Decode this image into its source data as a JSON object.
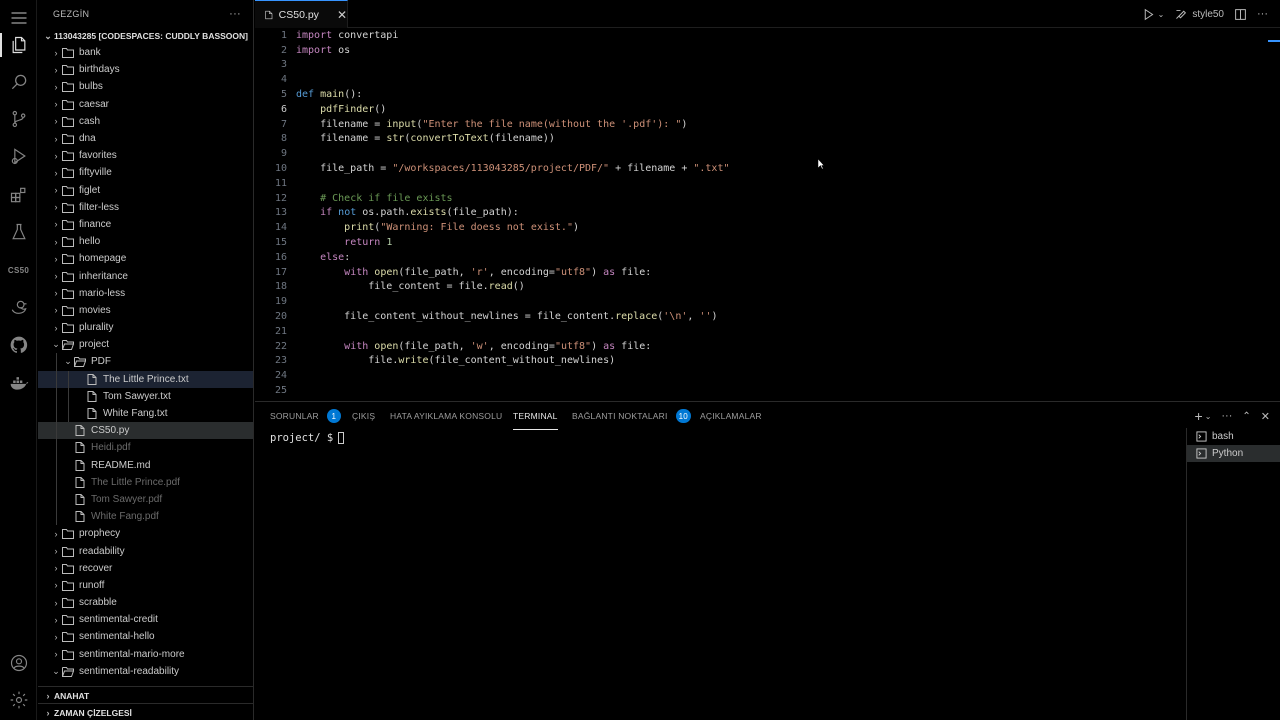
{
  "activity_bar": {
    "items": [
      {
        "icon": "menu-icon"
      },
      {
        "icon": "explorer-icon"
      },
      {
        "icon": "search-icon"
      },
      {
        "icon": "source-control-icon"
      },
      {
        "icon": "run-debug-icon"
      },
      {
        "icon": "extensions-icon"
      },
      {
        "icon": "testing-icon"
      },
      {
        "icon": "cs50-icon",
        "label": "CS50"
      },
      {
        "icon": "duck-icon"
      },
      {
        "icon": "github-icon"
      },
      {
        "icon": "docker-icon"
      },
      {
        "icon": "account-icon"
      },
      {
        "icon": "settings-icon"
      }
    ]
  },
  "sidebar": {
    "title": "GEZGİN",
    "more": "···",
    "workspace": "113043285 [CODESPACES: CUDDLY BASSOON]",
    "items": [
      {
        "label": "bank",
        "type": "folder"
      },
      {
        "label": "birthdays",
        "type": "folder"
      },
      {
        "label": "bulbs",
        "type": "folder"
      },
      {
        "label": "caesar",
        "type": "folder"
      },
      {
        "label": "cash",
        "type": "folder"
      },
      {
        "label": "dna",
        "type": "folder"
      },
      {
        "label": "favorites",
        "type": "folder"
      },
      {
        "label": "fiftyville",
        "type": "folder"
      },
      {
        "label": "figlet",
        "type": "folder"
      },
      {
        "label": "filter-less",
        "type": "folder"
      },
      {
        "label": "finance",
        "type": "folder"
      },
      {
        "label": "hello",
        "type": "folder"
      },
      {
        "label": "homepage",
        "type": "folder"
      },
      {
        "label": "inheritance",
        "type": "folder"
      },
      {
        "label": "mario-less",
        "type": "folder"
      },
      {
        "label": "movies",
        "type": "folder"
      },
      {
        "label": "plurality",
        "type": "folder"
      },
      {
        "label": "project",
        "type": "folder-open"
      },
      {
        "label": "PDF",
        "type": "folder-open"
      },
      {
        "label": "The Little Prince.txt",
        "type": "file"
      },
      {
        "label": "Tom Sawyer.txt",
        "type": "file"
      },
      {
        "label": "White Fang.txt",
        "type": "file"
      },
      {
        "label": "CS50.py",
        "type": "file"
      },
      {
        "label": "Heidi.pdf",
        "type": "file"
      },
      {
        "label": "README.md",
        "type": "file"
      },
      {
        "label": "The Little Prince.pdf",
        "type": "file"
      },
      {
        "label": "Tom Sawyer.pdf",
        "type": "file"
      },
      {
        "label": "White Fang.pdf",
        "type": "file"
      },
      {
        "label": "prophecy",
        "type": "folder"
      },
      {
        "label": "readability",
        "type": "folder"
      },
      {
        "label": "recover",
        "type": "folder"
      },
      {
        "label": "runoff",
        "type": "folder"
      },
      {
        "label": "scrabble",
        "type": "folder"
      },
      {
        "label": "sentimental-credit",
        "type": "folder"
      },
      {
        "label": "sentimental-hello",
        "type": "folder"
      },
      {
        "label": "sentimental-mario-more",
        "type": "folder"
      },
      {
        "label": "sentimental-readability",
        "type": "folder-open"
      }
    ],
    "outline": "ANAHAT",
    "timeline": "ZAMAN ÇİZELGESİ"
  },
  "editor": {
    "tab_label": "CS50.py",
    "tab_close": "✕",
    "toolbar_label": "style50",
    "current_line": "6",
    "lines": [
      {
        "n": "1",
        "html": "<span class='kw'>import</span> convertapi"
      },
      {
        "n": "2",
        "html": "<span class='kw'>import</span> os"
      },
      {
        "n": "3",
        "html": ""
      },
      {
        "n": "4",
        "html": ""
      },
      {
        "n": "5",
        "html": "<span class='def'>def</span> <span class='fn'>main</span>():"
      },
      {
        "n": "6",
        "html": "    <span class='fn'>pdfFinder</span>()"
      },
      {
        "n": "7",
        "html": "    filename = <span class='fn'>input</span>(<span class='str'>\"Enter the file name(without the '.pdf'): \"</span>)"
      },
      {
        "n": "8",
        "html": "    filename = <span class='fn'>str</span>(<span class='fn'>convertToText</span>(filename))"
      },
      {
        "n": "9",
        "html": ""
      },
      {
        "n": "10",
        "html": "    file_path = <span class='str'>\"/workspaces/113043285/project/PDF/\"</span> + filename + <span class='str'>\".txt\"</span>"
      },
      {
        "n": "11",
        "html": ""
      },
      {
        "n": "12",
        "html": "    <span class='com'># Check if file exists</span>"
      },
      {
        "n": "13",
        "html": "    <span class='kw'>if</span> <span class='def'>not</span> os.path.<span class='fn'>exists</span>(file_path):"
      },
      {
        "n": "14",
        "html": "        <span class='fn'>print</span>(<span class='str'>\"Warning: File doess not exist.\"</span>)"
      },
      {
        "n": "15",
        "html": "        <span class='kw'>return</span> <span class='num'>1</span>"
      },
      {
        "n": "16",
        "html": "    <span class='kw'>else</span>:"
      },
      {
        "n": "17",
        "html": "        <span class='kw'>with</span> <span class='fn'>open</span>(file_path, <span class='str'>'r'</span>, encoding=<span class='str'>\"utf8\"</span>) <span class='kw'>as</span> file:"
      },
      {
        "n": "18",
        "html": "            file_content = file.<span class='fn'>read</span>()"
      },
      {
        "n": "19",
        "html": ""
      },
      {
        "n": "20",
        "html": "        file_content_without_newlines = file_content.<span class='fn'>replace</span>(<span class='str'>'\\n'</span>, <span class='str'>''</span>)"
      },
      {
        "n": "21",
        "html": ""
      },
      {
        "n": "22",
        "html": "        <span class='kw'>with</span> <span class='fn'>open</span>(file_path, <span class='str'>'w'</span>, encoding=<span class='str'>\"utf8\"</span>) <span class='kw'>as</span> file:"
      },
      {
        "n": "23",
        "html": "            file.<span class='fn'>write</span>(file_content_without_newlines)"
      },
      {
        "n": "24",
        "html": ""
      },
      {
        "n": "25",
        "html": ""
      }
    ]
  },
  "panel": {
    "tabs": [
      {
        "label": "SORUNLAR",
        "badge": "1"
      },
      {
        "label": "ÇIKIŞ"
      },
      {
        "label": "HATA AYIKLAMA KONSOLU"
      },
      {
        "label": "TERMINAL",
        "active": true
      },
      {
        "label": "BAĞLANTI NOKTALARI",
        "badge": "10"
      },
      {
        "label": "AÇIKLAMALAR"
      }
    ],
    "terminal_prompt": "project/ $",
    "terminals": [
      {
        "label": "bash"
      },
      {
        "label": "Python",
        "active": true
      }
    ]
  },
  "colors": {
    "accent": "#3794ff",
    "badge": "#0078d4",
    "background": "#000000"
  }
}
